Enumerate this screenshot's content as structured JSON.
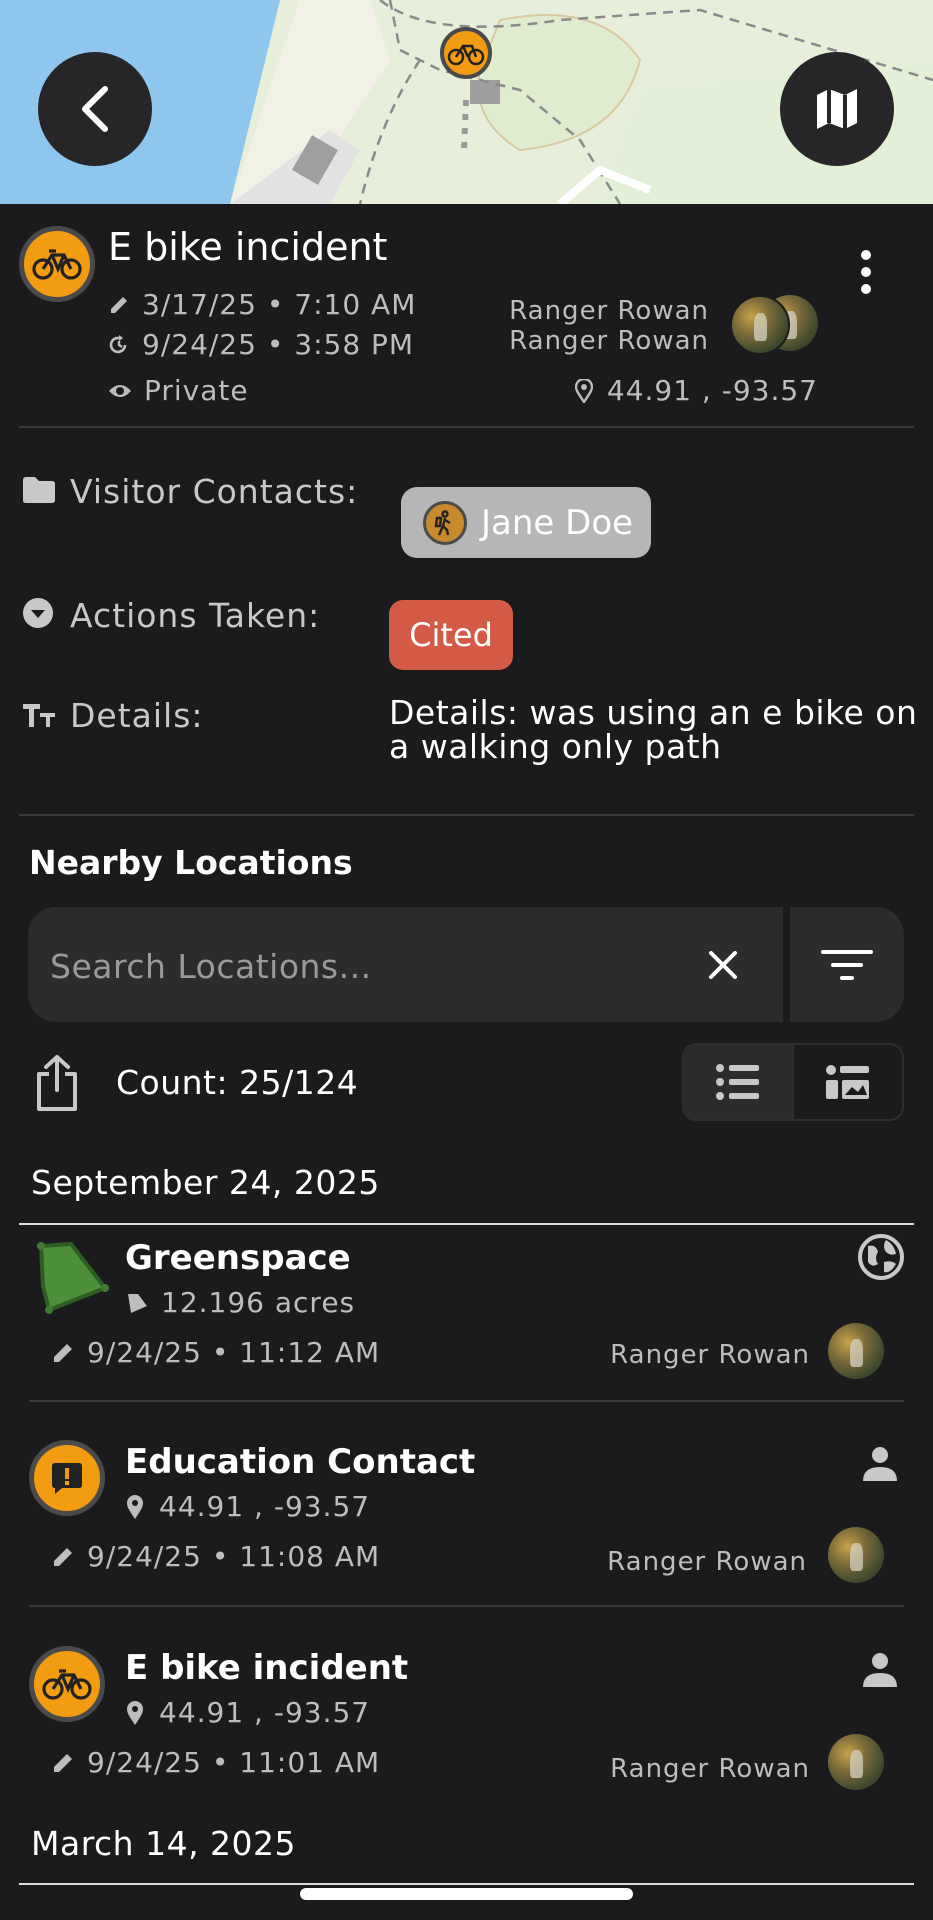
{
  "header": {
    "title": "E bike incident",
    "created": "3/17/25 • 7:10 AM",
    "updated": "9/24/25 • 3:58 PM",
    "visibility": "Private",
    "creator": "Ranger Rowan",
    "editor": "Ranger Rowan",
    "coords": "44.91 , -93.57"
  },
  "fields": {
    "visitor_contacts_label": "Visitor Contacts:",
    "visitor_contact_chip": "Jane Doe",
    "actions_label": "Actions Taken:",
    "actions_chip": "Cited",
    "details_label": "Details:",
    "details_value": "Details: was using an e bike on a walking only path"
  },
  "nearby": {
    "heading": "Nearby Locations",
    "search_placeholder": "Search Locations...",
    "count": "Count: 25/124"
  },
  "groups": [
    {
      "date": "September 24, 2025",
      "items": [
        {
          "title": "Greenspace",
          "sub": "12.196 acres",
          "time": "9/24/25 • 11:12 AM",
          "user": "Ranger Rowan"
        },
        {
          "title": "Education Contact",
          "sub": "44.91 , -93.57",
          "time": "9/24/25 • 11:08 AM",
          "user": "Ranger Rowan"
        },
        {
          "title": "E bike incident",
          "sub": "44.91 , -93.57",
          "time": "9/24/25 • 11:01 AM",
          "user": "Ranger Rowan"
        }
      ]
    },
    {
      "date": "March 14, 2025"
    }
  ],
  "colors": {
    "background": "#1b1a1c",
    "accent_orange": "#f39c12",
    "cited_red": "#d35a44",
    "greenspace": "#4d8f3a",
    "map_water": "#8ec6ee",
    "map_land": "#e6f0d8"
  },
  "icons": {
    "back": "chevron-left-icon",
    "map": "map-icon",
    "more": "more-vertical-icon",
    "edit": "pencil-icon",
    "history": "history-icon",
    "visibility": "eye-icon",
    "location": "pin-icon",
    "folder": "folder-icon",
    "dropdown": "dropdown-circle-icon",
    "text": "text-size-icon",
    "clear": "close-icon",
    "filter": "filter-icon",
    "share": "share-icon",
    "list_view": "list-icon",
    "card_view": "card-list-icon",
    "globe": "globe-icon",
    "person": "person-icon",
    "bike": "bike-icon",
    "alert": "alert-icon",
    "hiker": "hiker-icon",
    "area": "area-icon"
  }
}
